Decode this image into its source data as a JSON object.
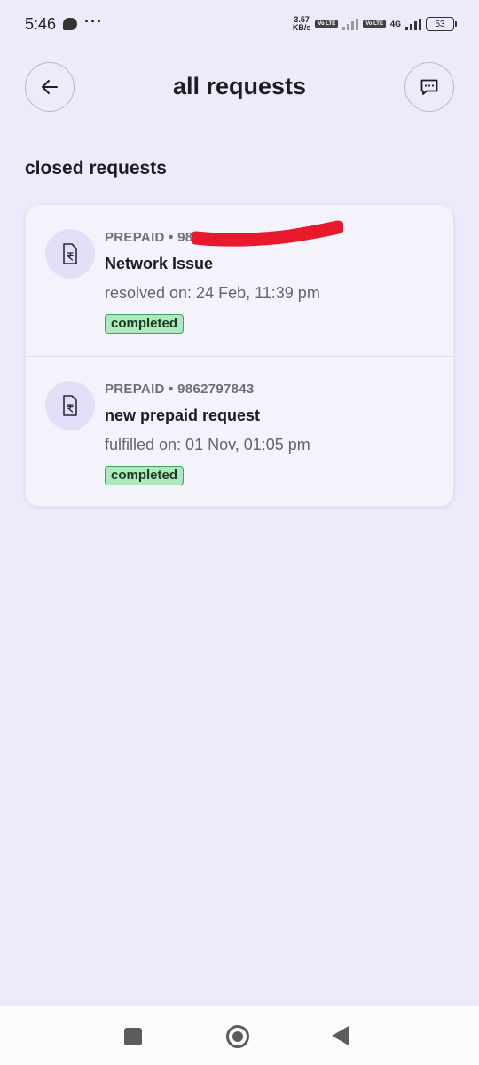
{
  "status_bar": {
    "time": "5:46",
    "more": "···",
    "speed_value": "3.57",
    "speed_unit": "KB/s",
    "volte_1": "Vo LTE",
    "volte_2": "Vo LTE",
    "network_type": "4G",
    "battery": "53"
  },
  "header": {
    "title": "all requests"
  },
  "section": {
    "title": "closed requests"
  },
  "requests": [
    {
      "meta": "PREPAID • 98",
      "title": "Network Issue",
      "date": "resolved on: 24 Feb, 11:39 pm",
      "status": "completed"
    },
    {
      "meta": "PREPAID • 9862797843",
      "title": "new prepaid request",
      "date": "fulfilled on: 01 Nov, 01:05 pm",
      "status": "completed"
    }
  ],
  "colors": {
    "background": "#ECEBFB",
    "card": "#F4F3FC",
    "badge_bg": "#AEE9BE",
    "badge_border": "#3aa55c",
    "redaction": "#E8192C"
  }
}
